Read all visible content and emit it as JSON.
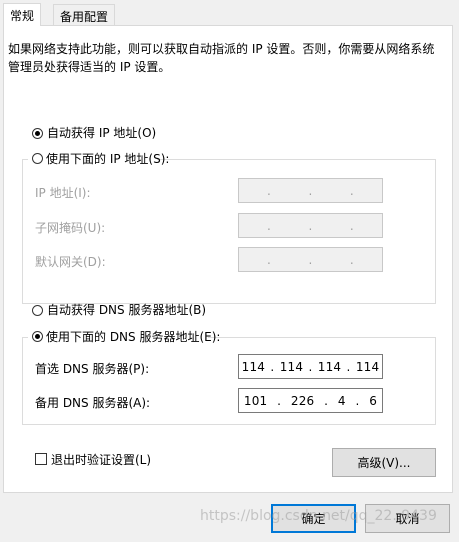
{
  "tabs": [
    {
      "label": "常规",
      "active": true
    },
    {
      "label": "备用配置",
      "active": false
    }
  ],
  "description": "如果网络支持此功能，则可以获取自动指派的 IP 设置。否则，你需要从网络系统管理员处获得适当的 IP 设置。",
  "ip_section": {
    "auto_label": "自动获得 IP 地址(O)",
    "manual_label": "使用下面的 IP 地址(S):",
    "auto_selected": true,
    "fields": [
      {
        "label": "IP 地址(I):",
        "octets": [
          "",
          "",
          "",
          ""
        ]
      },
      {
        "label": "子网掩码(U):",
        "octets": [
          "",
          "",
          "",
          ""
        ]
      },
      {
        "label": "默认网关(D):",
        "octets": [
          "",
          "",
          "",
          ""
        ]
      }
    ]
  },
  "dns_section": {
    "auto_label": "自动获得 DNS 服务器地址(B)",
    "manual_label": "使用下面的 DNS 服务器地址(E):",
    "manual_selected": true,
    "fields": [
      {
        "label": "首选 DNS 服务器(P):",
        "octets": [
          "114",
          "114",
          "114",
          "114"
        ]
      },
      {
        "label": "备用 DNS 服务器(A):",
        "octets": [
          "101",
          "226",
          "4",
          "6"
        ]
      }
    ]
  },
  "validate_label": "退出时验证设置(L)",
  "advanced_button": "高级(V)...",
  "ok_button": "确定",
  "cancel_button": "取消",
  "watermark": "https://blog.csdn.net/qq_22..9439"
}
